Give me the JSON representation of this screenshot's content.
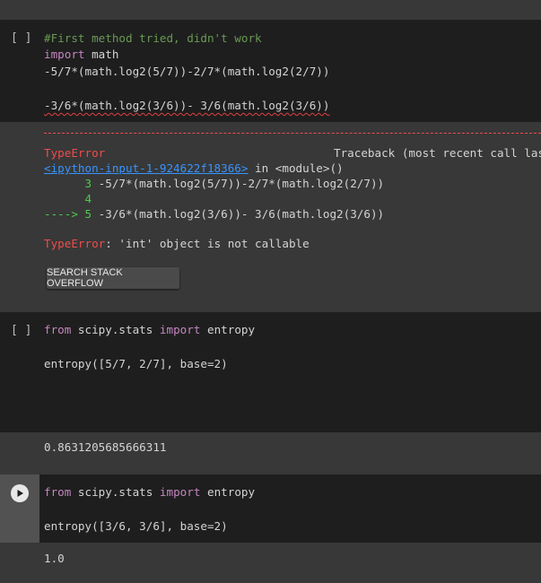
{
  "cells": [
    {
      "bracket": "[ ]",
      "code": {
        "comment": "#First method tried, didn't work",
        "import_kw": "import",
        "import_mod": " math",
        "line3": "-5/7*(math.log2(5/7))-2/7*(math.log2(2/7))",
        "line5": "-3/6*(math.log2(3/6))- 3/6(math.log2(3/6))"
      },
      "output": {
        "err_name": "TypeError",
        "traceback_label": "Traceback (most recent call last)",
        "link": "<ipython-input-1-924622f18366>",
        "in_module": " in <module>()",
        "tb_num3": "      3 ",
        "tb_line3": "-5/7*(math.log2(5/7))-2/7*(math.log2(2/7))",
        "tb_num4": "      4",
        "tb_arrow": "----> 5 ",
        "tb_line5": "-3/6*(math.log2(3/6))- 3/6(math.log2(3/6))",
        "err_name2": "TypeError",
        "err_msg": ": 'int' object is not callable",
        "so_button": "SEARCH STACK OVERFLOW"
      }
    },
    {
      "bracket": "[ ]",
      "code": {
        "from_kw": "from",
        "mod": " scipy.stats ",
        "import_kw": "import",
        "name": " entropy",
        "call": "entropy([5/7, 2/7], base=2)"
      },
      "output": {
        "result": "0.8631205685666311"
      }
    },
    {
      "code": {
        "from_kw": "from",
        "mod": " scipy.stats ",
        "import_kw": "import",
        "name": " entropy",
        "call": "entropy([3/6, 3/6], base=2)"
      },
      "output": {
        "result": "1.0"
      }
    }
  ]
}
